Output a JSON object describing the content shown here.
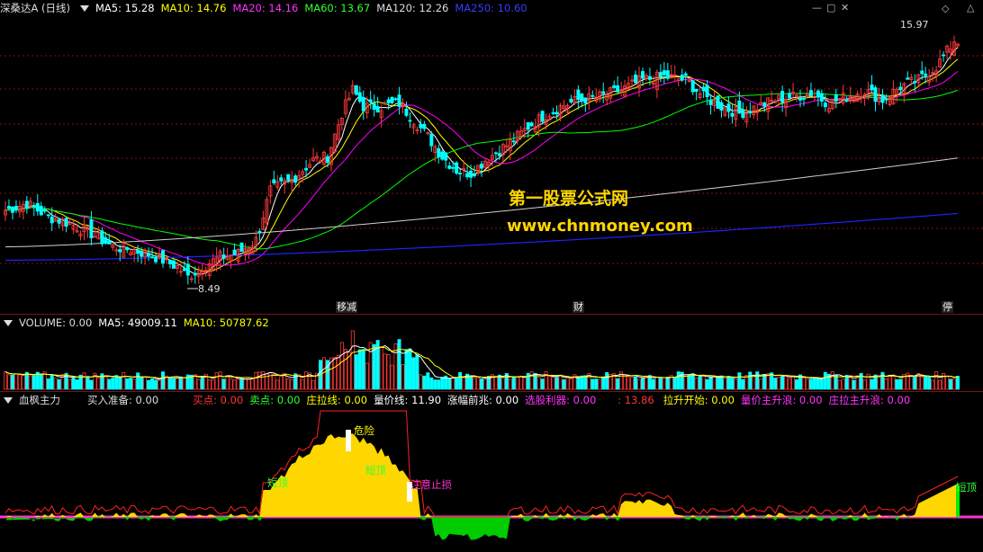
{
  "colors": {
    "up": "#ff3a3a",
    "down": "#00ffff",
    "ma5": "#ffffff",
    "ma10": "#ffff00",
    "ma20": "#ff00ff",
    "ma60": "#00ff00",
    "ma120": "#d0d0d0",
    "ma250": "#2020ff",
    "grid": "#7a1414",
    "area": "#ffd700",
    "neg": "#00cc00",
    "red": "#ff2020",
    "pink": "#ff33cc"
  },
  "header": {
    "stock": "深桑达A (日线)",
    "ma5": "MA5: 15.28",
    "ma10": "MA10: 14.76",
    "ma20": "MA20: 14.16",
    "ma60": "MA60: 13.67",
    "ma120": "MA120: 12.26",
    "ma250": "MA250: 10.60"
  },
  "price_pane": {
    "high_label": "15.97",
    "low_label": "8.49",
    "events": [
      "移减",
      "财",
      "停"
    ],
    "icons": [
      "minimize-icon",
      "maximize-icon",
      "close-icon",
      "diamond-icon",
      "triangle-icon"
    ]
  },
  "watermark": {
    "line1": "第一股票公式网",
    "line2": "www.chnmoney.com"
  },
  "volume_header": {
    "volume": "VOLUME: 0.00",
    "ma5": "MA5: 49009.11",
    "ma10": "MA10: 50787.62"
  },
  "ind_header": {
    "name": "血枫主力",
    "buy_prep": "买入准备: 0.00",
    "buy": "买点: 0.00",
    "sell": "卖点: 0.00",
    "zhuang": "庄拉线: 0.00",
    "liang": "量价线: 11.90",
    "zhangfu": "涨幅前兆: 0.00",
    "xuangu": "选股利器: 0.00",
    "val": ": 13.86",
    "lasheng": "拉升开始: 0.00",
    "liangjia": "量价主升浪: 0.00",
    "zhuangla": "庄拉主升浪: 0.00"
  },
  "ind_annotations": [
    "短顶",
    "危险",
    "短顶",
    "注意止损",
    "短顶"
  ],
  "chart_data": {
    "type": "candlestick",
    "title": "深桑达A (日线)",
    "y_range": [
      8.0,
      16.4
    ],
    "price_high": 15.97,
    "price_low": 8.49,
    "keypoints_close": [
      [
        0,
        10.7
      ],
      [
        6,
        10.9
      ],
      [
        12,
        10.5
      ],
      [
        18,
        10.3
      ],
      [
        24,
        10.0
      ],
      [
        30,
        9.6
      ],
      [
        36,
        9.5
      ],
      [
        42,
        9.3
      ],
      [
        48,
        9.0
      ],
      [
        51,
        8.7
      ],
      [
        55,
        9.0
      ],
      [
        60,
        9.3
      ],
      [
        65,
        9.4
      ],
      [
        70,
        9.8
      ],
      [
        74,
        11.3
      ],
      [
        80,
        11.6
      ],
      [
        86,
        12.2
      ],
      [
        90,
        12.3
      ],
      [
        94,
        13.6
      ],
      [
        97,
        14.3
      ],
      [
        100,
        13.8
      ],
      [
        105,
        13.8
      ],
      [
        110,
        13.9
      ],
      [
        114,
        13.4
      ],
      [
        118,
        12.9
      ],
      [
        122,
        12.3
      ],
      [
        126,
        11.9
      ],
      [
        130,
        11.8
      ],
      [
        134,
        12.2
      ],
      [
        138,
        12.5
      ],
      [
        142,
        12.8
      ],
      [
        146,
        13.2
      ],
      [
        150,
        13.5
      ],
      [
        155,
        13.8
      ],
      [
        160,
        14.0
      ],
      [
        166,
        14.1
      ],
      [
        172,
        14.3
      ],
      [
        178,
        14.6
      ],
      [
        184,
        14.7
      ],
      [
        190,
        14.6
      ],
      [
        195,
        14.1
      ],
      [
        200,
        13.8
      ],
      [
        205,
        13.6
      ],
      [
        210,
        13.8
      ],
      [
        215,
        14.0
      ],
      [
        220,
        14.1
      ],
      [
        225,
        14.2
      ],
      [
        230,
        13.9
      ],
      [
        235,
        14.1
      ],
      [
        240,
        14.3
      ],
      [
        245,
        14.0
      ],
      [
        250,
        14.4
      ],
      [
        255,
        14.6
      ],
      [
        260,
        15.0
      ],
      [
        264,
        15.6
      ],
      [
        266,
        15.97
      ]
    ],
    "ma250_range": [
      9.2,
      10.6
    ],
    "ma120_range": [
      9.6,
      12.26
    ],
    "volume": {
      "ma5": 49009.11,
      "ma10": 50787.62,
      "spike_index": 97
    },
    "indicator": {
      "liangjia_line": 11.9,
      "value": 13.86
    }
  }
}
